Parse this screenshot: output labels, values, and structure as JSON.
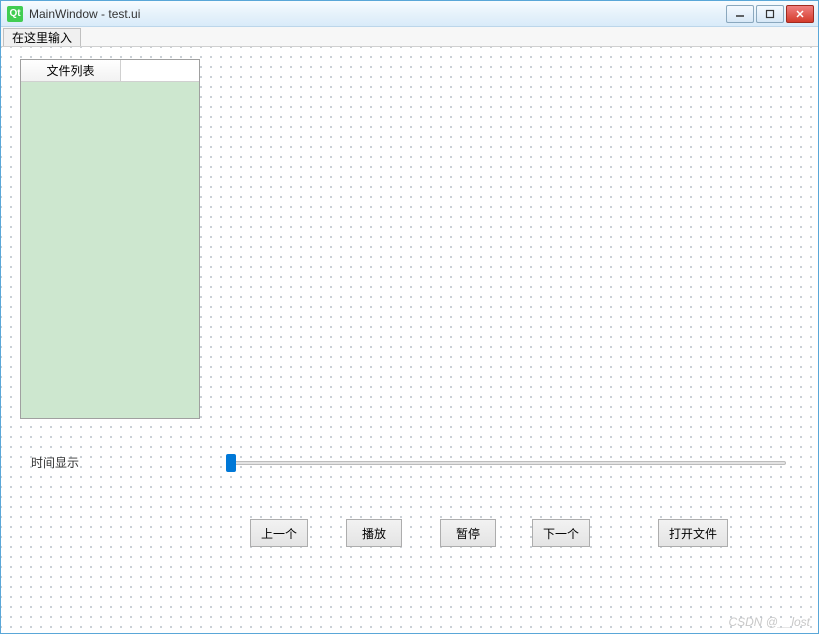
{
  "window": {
    "title": "MainWindow - test.ui",
    "icon_label": "Qt"
  },
  "menubar": {
    "items": [
      {
        "label": "在这里输入"
      }
    ]
  },
  "file_list": {
    "header": "文件列表"
  },
  "time": {
    "label": "时间显示"
  },
  "slider": {
    "value": 0,
    "min": 0,
    "max": 100
  },
  "buttons": {
    "prev": "上一个",
    "play": "播放",
    "pause": "暂停",
    "next": "下一个",
    "open": "打开文件"
  },
  "watermark": "CSDN @__lost"
}
